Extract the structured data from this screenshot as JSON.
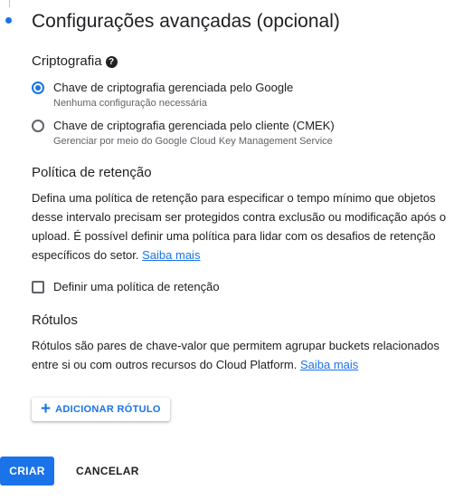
{
  "advanced": {
    "title": "Configurações avançadas (opcional)",
    "colors": {
      "accent": "#1a73e8",
      "text": "#202124",
      "secondary_text": "#5f6368"
    }
  },
  "encryption": {
    "heading": "Criptografia",
    "help_icon": "?",
    "options": [
      {
        "label": "Chave de criptografia gerenciada pelo Google",
        "hint": "Nenhuma configuração necessária",
        "selected": true
      },
      {
        "label": "Chave de criptografia gerenciada pelo cliente (CMEK)",
        "hint": "Gerenciar por meio do Google Cloud Key Management Service",
        "selected": false
      }
    ]
  },
  "retention": {
    "heading": "Política de retenção",
    "description": "Defina uma política de retenção para especificar o tempo mínimo que objetos desse intervalo precisam ser protegidos contra exclusão ou modificação após o upload. É possível definir uma política para lidar com os desafios de retenção específicos do setor.",
    "learn_more": "Saiba mais",
    "checkbox_label": "Definir uma política de retenção",
    "checkbox_checked": false
  },
  "labels": {
    "heading": "Rótulos",
    "description": "Rótulos são pares de chave-valor que permitem agrupar buckets relacionados entre si ou com outros recursos do Cloud Platform.",
    "learn_more": "Saiba mais",
    "add_button_icon": "+",
    "add_button": "ADICIONAR RÓTULO"
  },
  "actions": {
    "create": "CRIAR",
    "cancel": "CANCELAR"
  }
}
